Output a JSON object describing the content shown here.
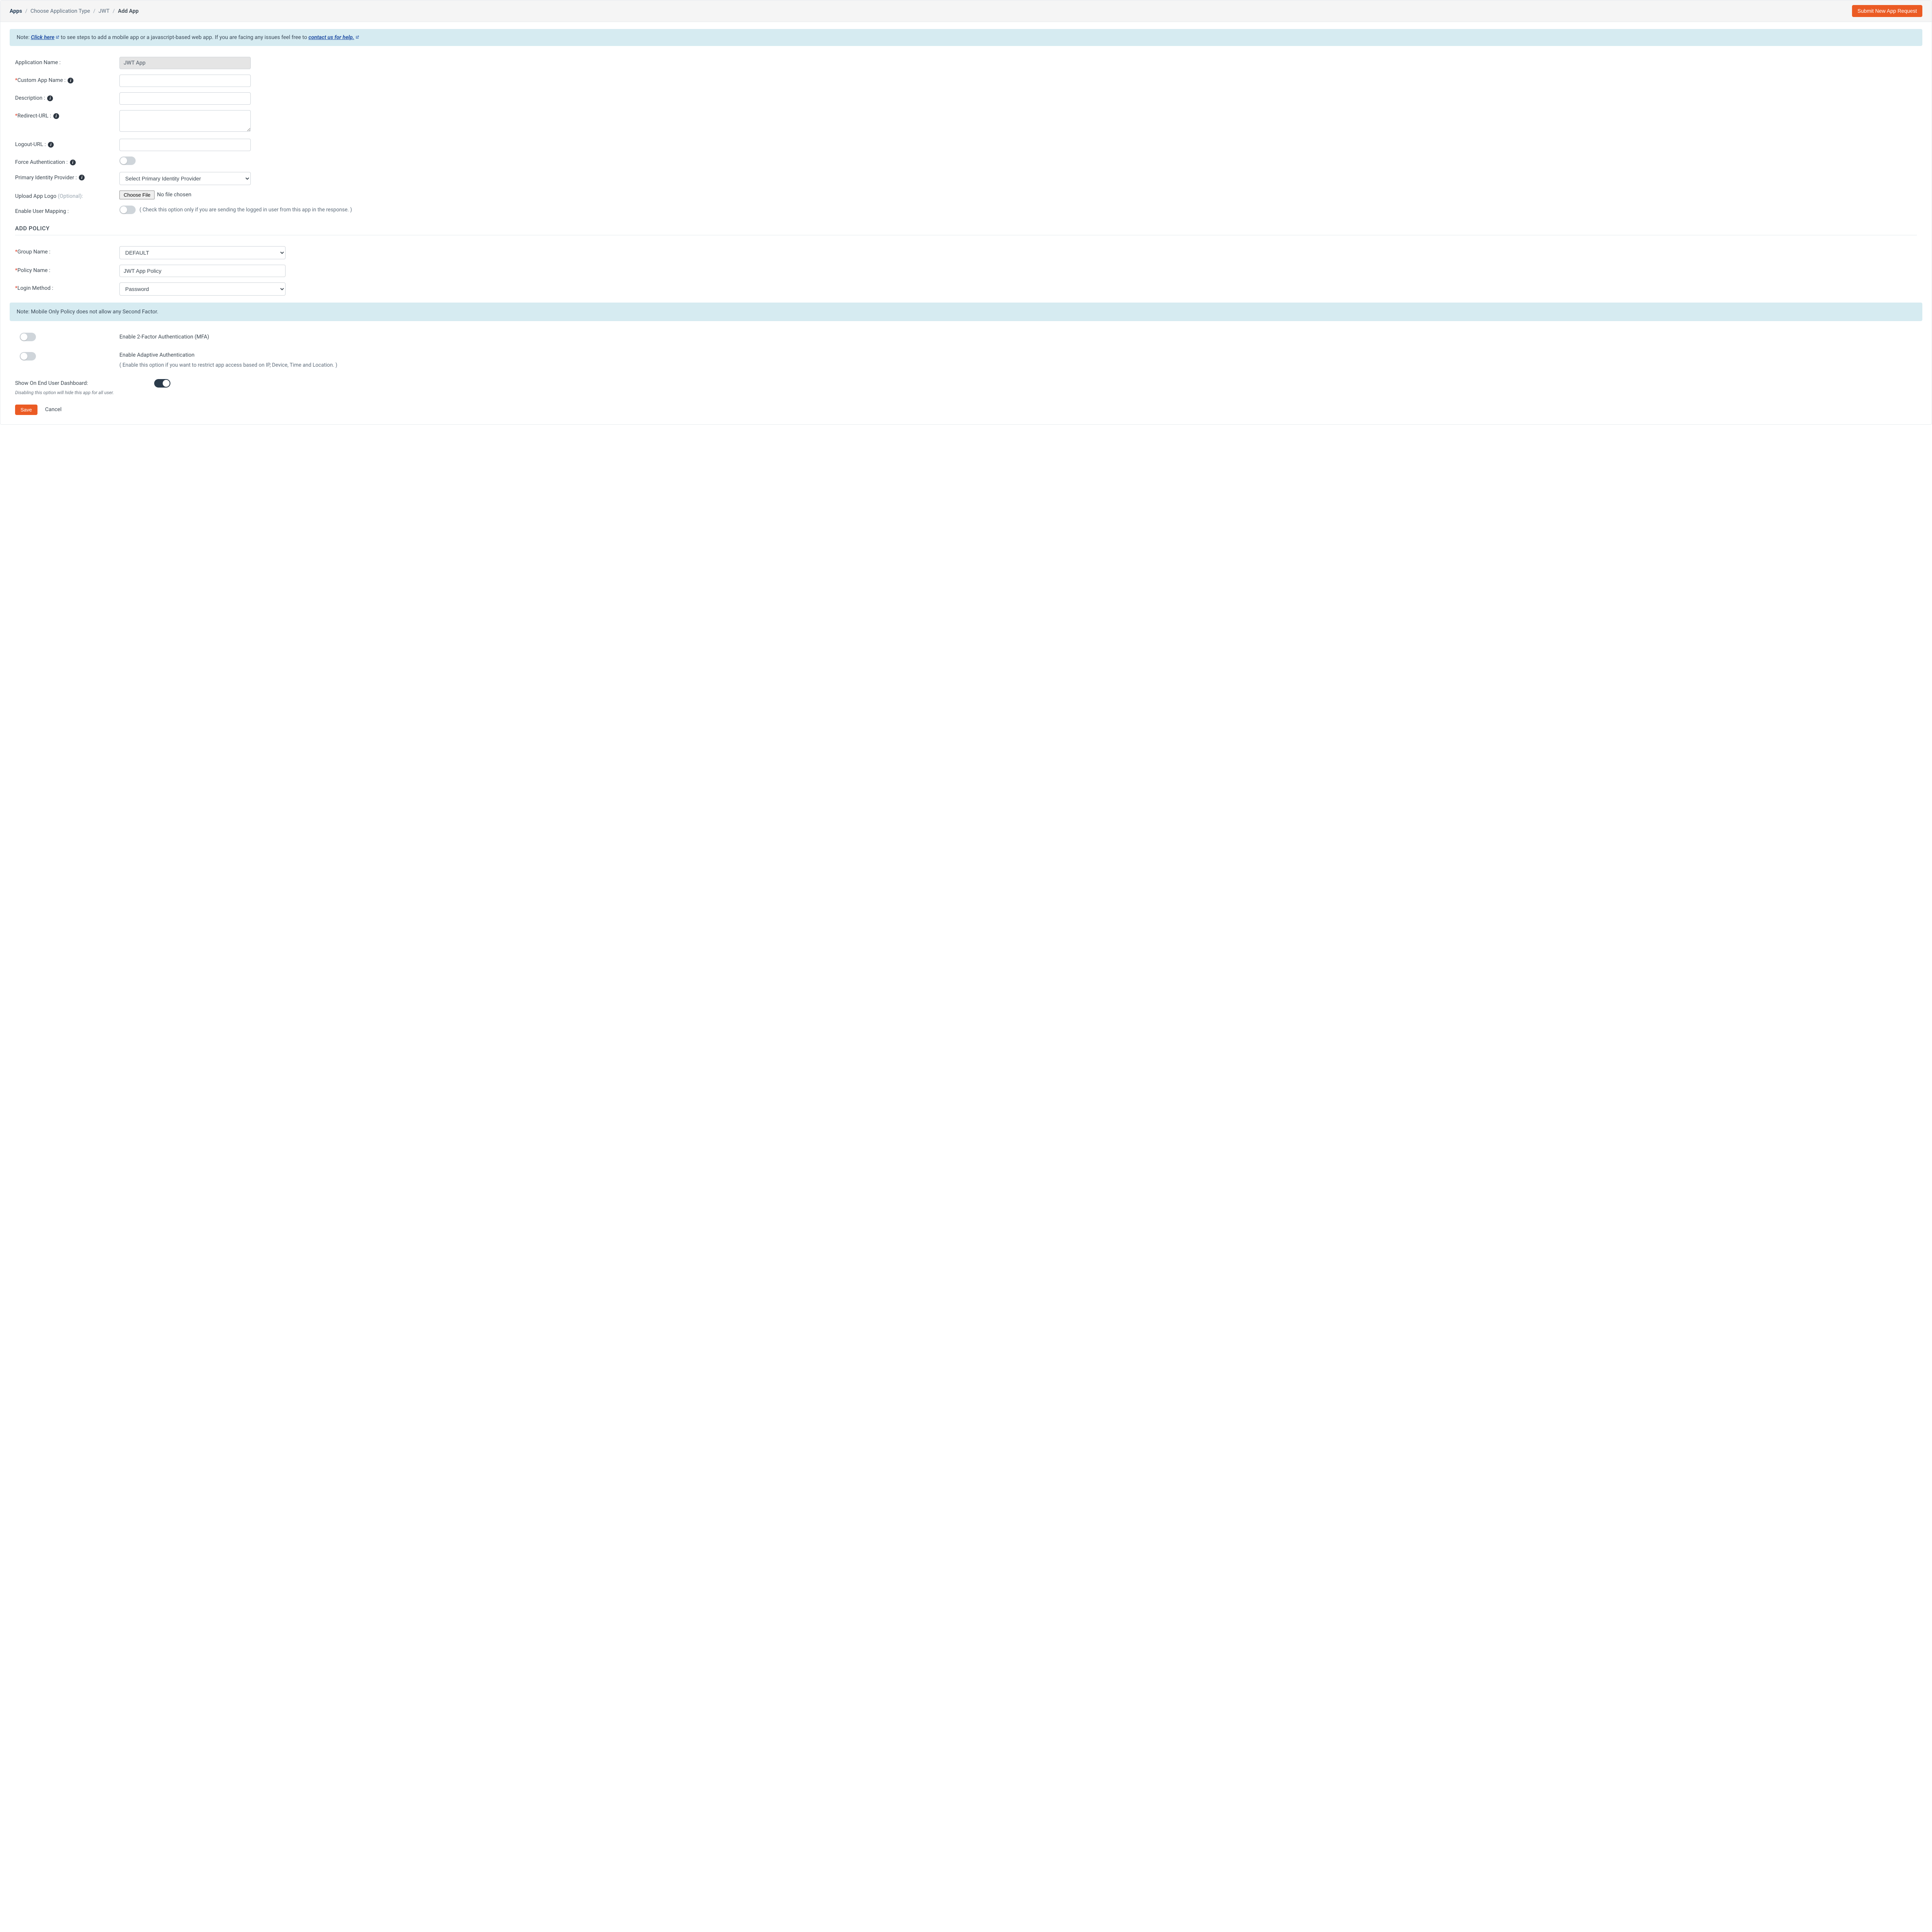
{
  "breadcrumb": {
    "apps": "Apps",
    "choose": "Choose Application Type",
    "jwt": "JWT",
    "add": "Add App"
  },
  "submit_button": "Submit New App Request",
  "note1": {
    "prefix": "Note: ",
    "link1": "Click here",
    "mid": " to see steps to add a mobile app or a javascript-based web app. If you are facing any issues feel free to ",
    "link2": "contact us for help."
  },
  "labels": {
    "app_name": "Application Name :",
    "custom_name": "Custom App Name :",
    "description": "Description :",
    "redirect": "Redirect-URL :",
    "logout": "Logout-URL :",
    "force_auth": "Force Authentication :",
    "idp": "Primary Identity Provider :",
    "logo": "Upload App Logo ",
    "logo_opt": "(Optional):",
    "user_mapping": "Enable User Mapping :",
    "group_name": "Group Name :",
    "policy_name": "Policy Name :",
    "login_method": "Login Method :",
    "mfa": "Enable 2-Factor Authentication (MFA)",
    "adaptive": "Enable Adaptive Authentication",
    "adaptive_note": "( Enable this option if you want to restrict app access based on IP, Device, Time and Location. )",
    "show_dashboard": "Show On End User Dashboard:",
    "dash_note": "Disabling this option will hide this app for all user.",
    "user_mapping_note": "( Check this option only if you are sending the logged in user from this app in the response. )"
  },
  "values": {
    "app_name": "JWT App",
    "idp_placeholder": "Select Primary Identity Provider",
    "file_btn": "Choose File",
    "file_status": "No file chosen",
    "group_name": "DEFAULT",
    "policy_name": "JWT App Policy",
    "login_method": "Password"
  },
  "section": {
    "add_policy": "ADD POLICY"
  },
  "note2": "Note: Mobile Only Policy does not allow any Second Factor.",
  "actions": {
    "save": "Save",
    "cancel": "Cancel"
  }
}
